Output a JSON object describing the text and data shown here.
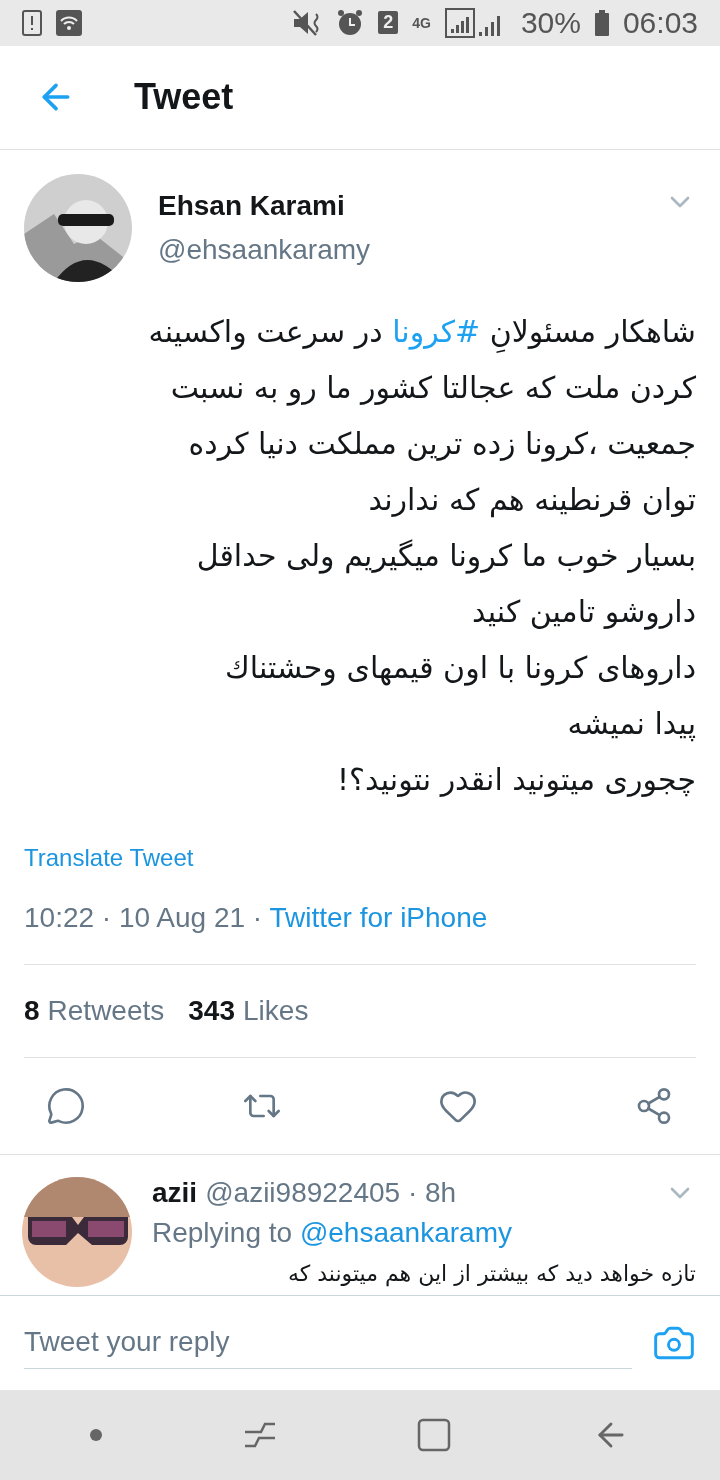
{
  "status_bar": {
    "battery": "30%",
    "time": "06:03",
    "sim": "2",
    "network": "4G"
  },
  "header": {
    "title": "Tweet"
  },
  "tweet": {
    "name": "Ehsan Karami",
    "handle": "@ehsaankaramy",
    "body": [
      [
        {
          "kind": "text",
          "text": "شاهکار مسئولانِ "
        },
        {
          "kind": "hashtag",
          "text": "#کرونا"
        },
        {
          "kind": "text",
          "text": " در سرعت واکسینه"
        }
      ],
      [
        {
          "kind": "text",
          "text": "کردن ملت که عجالتا کشور ما رو به نسبت"
        }
      ],
      [
        {
          "kind": "text",
          "text": "جمعیت ،کرونا زده ترین مملکت دنیا کرده"
        }
      ],
      [
        {
          "kind": "text",
          "text": "توان قرنطینه هم که ندارند"
        }
      ],
      [
        {
          "kind": "text",
          "text": "بسیار خوب ما کرونا میگیریم ولی حداقل"
        }
      ],
      [
        {
          "kind": "text",
          "text": "داروشو تامین کنید"
        }
      ],
      [
        {
          "kind": "text",
          "text": "داروهای کرونا با اون قیمهای وحشتناك"
        }
      ],
      [
        {
          "kind": "text",
          "text": "پیدا نمیشه"
        }
      ],
      [
        {
          "kind": "text",
          "text": "چجوری میتونید انقدر نتونید؟!"
        }
      ]
    ],
    "translate": "Translate Tweet",
    "time": "10:22 · 10 Aug 21 · ",
    "source": "Twitter for iPhone",
    "retweets": {
      "count": "8",
      "label": "Retweets"
    },
    "likes": {
      "count": "343",
      "label": "Likes"
    },
    "actions": [
      {
        "kind": "reply"
      },
      {
        "kind": "retweet"
      },
      {
        "kind": "like",
        "selected": false
      },
      {
        "kind": "share"
      }
    ]
  },
  "reply": {
    "name": "azii",
    "handle": "@azii98922405 · 8h",
    "replying_to": "Replying to ",
    "mention": "@ehsaankaramy",
    "text": "تازه خواهد دید که بیشتر از این هم میتونند که"
  },
  "composer": {
    "placeholder": "Tweet your reply"
  }
}
